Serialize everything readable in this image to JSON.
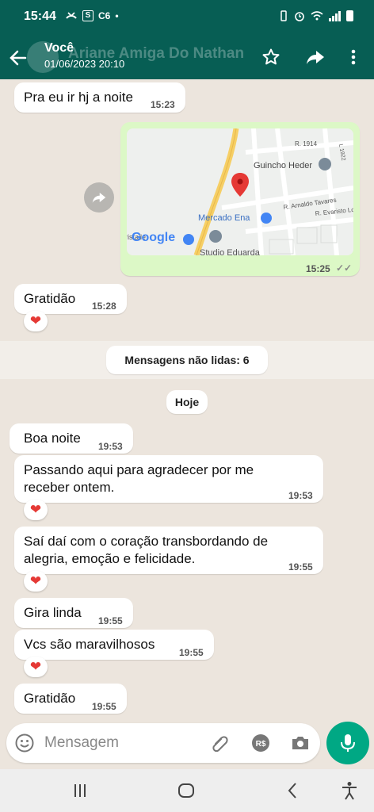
{
  "status_bar": {
    "time": "15:44",
    "left_badges": [
      "S",
      "C6"
    ],
    "dot": "•"
  },
  "header": {
    "title": "Você",
    "subtitle": "01/06/2023 20:10",
    "ghost_title": "Ariane Amiga Do Nathan"
  },
  "messages": [
    {
      "text": "Pra eu ir hj a noite",
      "time": "15:23"
    },
    {
      "map": {
        "labels": [
          "Guincho Heder",
          "Mercado Ena",
          "R. Arnaldo Tavares",
          "R. Evaristo Lop",
          "Studio Eduarda",
          "R. 1914",
          "L 1922",
          "ristalle",
          "Google"
        ]
      },
      "time": "15:25",
      "read": "✓✓"
    },
    {
      "text": "Gratidão",
      "time": "15:28",
      "reaction": "❤"
    },
    {
      "text": "Boa noite",
      "time": "19:53"
    },
    {
      "text_lines": [
        "Passando aqui para agradecer por me",
        "receber ontem."
      ],
      "time": "19:53",
      "reaction": "❤"
    },
    {
      "text_lines": [
        "Saí daí com o coração transbordando de",
        "alegria, emoção e felicidade."
      ],
      "time": "19:55",
      "reaction": "❤"
    },
    {
      "text": "Gira linda",
      "time": "19:55"
    },
    {
      "text": "Vcs são maravilhosos",
      "time": "19:55",
      "reaction": "❤"
    },
    {
      "text": "Gratidão",
      "time": "19:55"
    }
  ],
  "unread_label": "Mensagens não lidas: 6",
  "date_label": "Hoje",
  "input": {
    "placeholder": "Mensagem"
  },
  "colors": {
    "header": "#075e54",
    "outgoing": "#dcf8c6",
    "accent": "#00a884",
    "background": "#ece5dd"
  },
  "icons": [
    "back-arrow-icon",
    "star-icon",
    "forward-icon",
    "more-vert-icon",
    "emoji-icon",
    "attach-icon",
    "payment-icon",
    "camera-icon",
    "mic-icon",
    "heart-icon",
    "map-pin-icon"
  ]
}
